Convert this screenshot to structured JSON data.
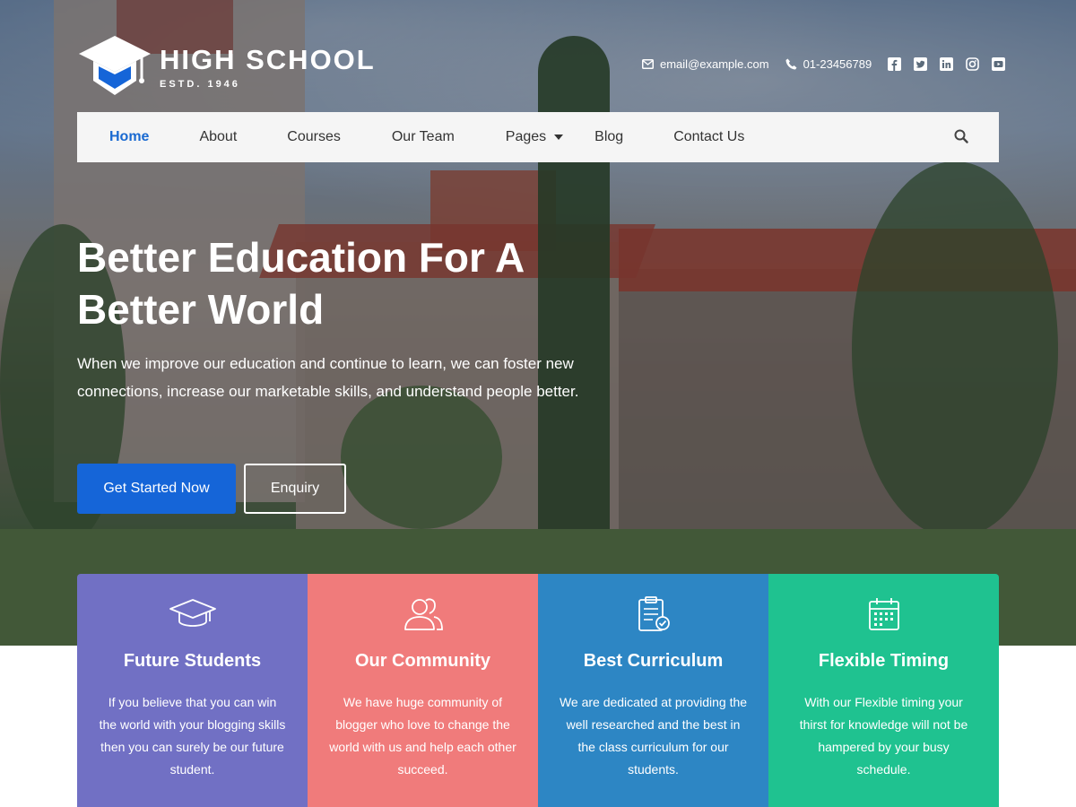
{
  "brand": {
    "title": "HIGH SCHOOL",
    "subtitle": "ESTD. 1946",
    "accent": "#1565d8"
  },
  "contact": {
    "email": "email@example.com",
    "phone": "01-23456789",
    "social": [
      "facebook-icon",
      "twitter-icon",
      "linkedin-icon",
      "instagram-icon",
      "youtube-icon"
    ]
  },
  "nav": {
    "items": [
      {
        "label": "Home",
        "active": true
      },
      {
        "label": "About"
      },
      {
        "label": "Courses"
      },
      {
        "label": "Our Team"
      },
      {
        "label": "Pages",
        "has_dropdown": true
      },
      {
        "label": "Blog"
      },
      {
        "label": "Contact Us"
      }
    ],
    "search_icon": "search-icon"
  },
  "hero": {
    "title_line1": "Better Education For A",
    "title_line2": "Better World",
    "text": "When we improve our education and continue to learn, we can foster new connections, increase our marketable skills, and understand people better.",
    "primary_button": "Get Started Now",
    "secondary_button": "Enquiry"
  },
  "features": [
    {
      "icon": "graduation-cap-icon",
      "title": "Future Students",
      "text": "If you believe that you can win the world with your blogging skills then you can surely be our future student.",
      "color": "#7170c4"
    },
    {
      "icon": "users-icon",
      "title": "Our Community",
      "text": "We have huge community of blogger who love to change the world with us and help each other succeed.",
      "color": "#f07b7b"
    },
    {
      "icon": "clipboard-check-icon",
      "title": "Best Curriculum",
      "text": "We are dedicated at providing the well researched and the best in the class curriculum for our students.",
      "color": "#2d86c4"
    },
    {
      "icon": "calendar-icon",
      "title": "Flexible Timing",
      "text": "With our Flexible timing your thirst for knowledge will not be hampered by your busy schedule.",
      "color": "#1fc290"
    }
  ]
}
